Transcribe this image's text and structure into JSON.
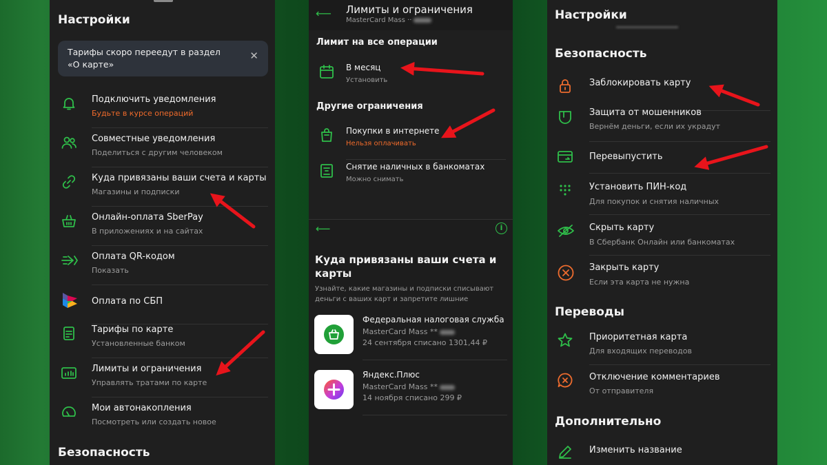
{
  "left_panel": {
    "title": "Настройки",
    "banner": {
      "text_line1": "Тарифы скоро переедут в раздел",
      "text_line2": "«О карте»"
    },
    "items": [
      {
        "title": "Подключить уведомления",
        "subtitle": "Будьте в курсе операций",
        "icon": "bell-icon",
        "subtitle_color": "#f06b2b"
      },
      {
        "title": "Совместные уведомления",
        "subtitle": "Поделиться с другим человеком",
        "icon": "users-icon"
      },
      {
        "title": "Куда привязаны ваши счета и карты",
        "subtitle": "Магазины и подписки",
        "icon": "link-icon"
      },
      {
        "title": "Онлайн-оплата SberPay",
        "subtitle": "В приложениях и на сайтах",
        "icon": "basket-icon"
      },
      {
        "title": "Оплата QR-кодом",
        "subtitle": "Показать",
        "icon": "qr-pay-icon"
      },
      {
        "title": "Оплата по СБП",
        "subtitle": "",
        "icon": "sbp-logo-icon"
      },
      {
        "title": "Тарифы по карте",
        "subtitle": "Установленные банком",
        "icon": "document-icon"
      },
      {
        "title": "Лимиты и ограничения",
        "subtitle": "Управлять тратами по карте",
        "icon": "chart-icon"
      },
      {
        "title": "Мои автонакопления",
        "subtitle": "Посмотреть или создать новое",
        "icon": "gauge-icon"
      }
    ],
    "bottom_section": "Безопасность"
  },
  "middle_panel": {
    "header_title": "Лимиты и ограничения",
    "header_subtitle": "MasterCard Mass ··",
    "section1": "Лимит на все операции",
    "monthly": {
      "title": "В месяц",
      "subtitle": "Установить"
    },
    "section2": "Другие ограничения",
    "internet": {
      "title": "Покупки в интернете",
      "subtitle": "Нельзя оплачивать"
    },
    "cash": {
      "title": "Снятие наличных в банкоматах",
      "subtitle": "Можно снимать"
    },
    "lower": {
      "title_line1": "Куда привязаны ваши счета и",
      "title_line2": "карты",
      "desc_line1": "Узнайте, какие магазины и подписки списывают",
      "desc_line2": "деньги с ваших карт и запретите лишние",
      "merchants": [
        {
          "name": "Федеральная налоговая служба",
          "card": "MasterCard Mass **",
          "line3": "24 сентября списано 1301,44 ₽"
        },
        {
          "name": "Яндекс.Плюс",
          "card": "MasterCard Mass **",
          "line3": "14 ноября списано 299 ₽"
        }
      ]
    }
  },
  "right_panel": {
    "title": "Настройки",
    "security_section": "Безопасность",
    "security_items": [
      {
        "title": "Заблокировать карту",
        "subtitle": "",
        "icon": "lock-icon"
      },
      {
        "title": "Защита от мошенников",
        "subtitle": "Вернём деньги, если их украдут",
        "icon": "shield-icon"
      },
      {
        "title": "Перевыпустить",
        "subtitle": "",
        "icon": "card-reissue-icon"
      },
      {
        "title": "Установить ПИН-код",
        "subtitle": "Для покупок и снятия наличных",
        "icon": "keypad-icon"
      },
      {
        "title": "Скрыть карту",
        "subtitle": "В Сбербанк Онлайн или банкоматах",
        "icon": "eye-off-icon"
      },
      {
        "title": "Закрыть карту",
        "subtitle": "Если эта карта не нужна",
        "icon": "close-circle-icon"
      }
    ],
    "transfers_section": "Переводы",
    "transfer_items": [
      {
        "title": "Приоритетная карта",
        "subtitle": "Для входящих переводов",
        "icon": "star-icon"
      },
      {
        "title": "Отключение комментариев",
        "subtitle": "От отправителя",
        "icon": "comment-off-icon"
      }
    ],
    "extra_section": "Дополнительно",
    "extra_items": [
      {
        "title": "Изменить название",
        "subtitle": "",
        "icon": "pencil-icon"
      }
    ]
  },
  "colors": {
    "accent_green": "#2fbf4a",
    "accent_orange": "#ee6c2e",
    "arrow_red": "#e8141b",
    "panel_bg": "#1f1f1f"
  }
}
